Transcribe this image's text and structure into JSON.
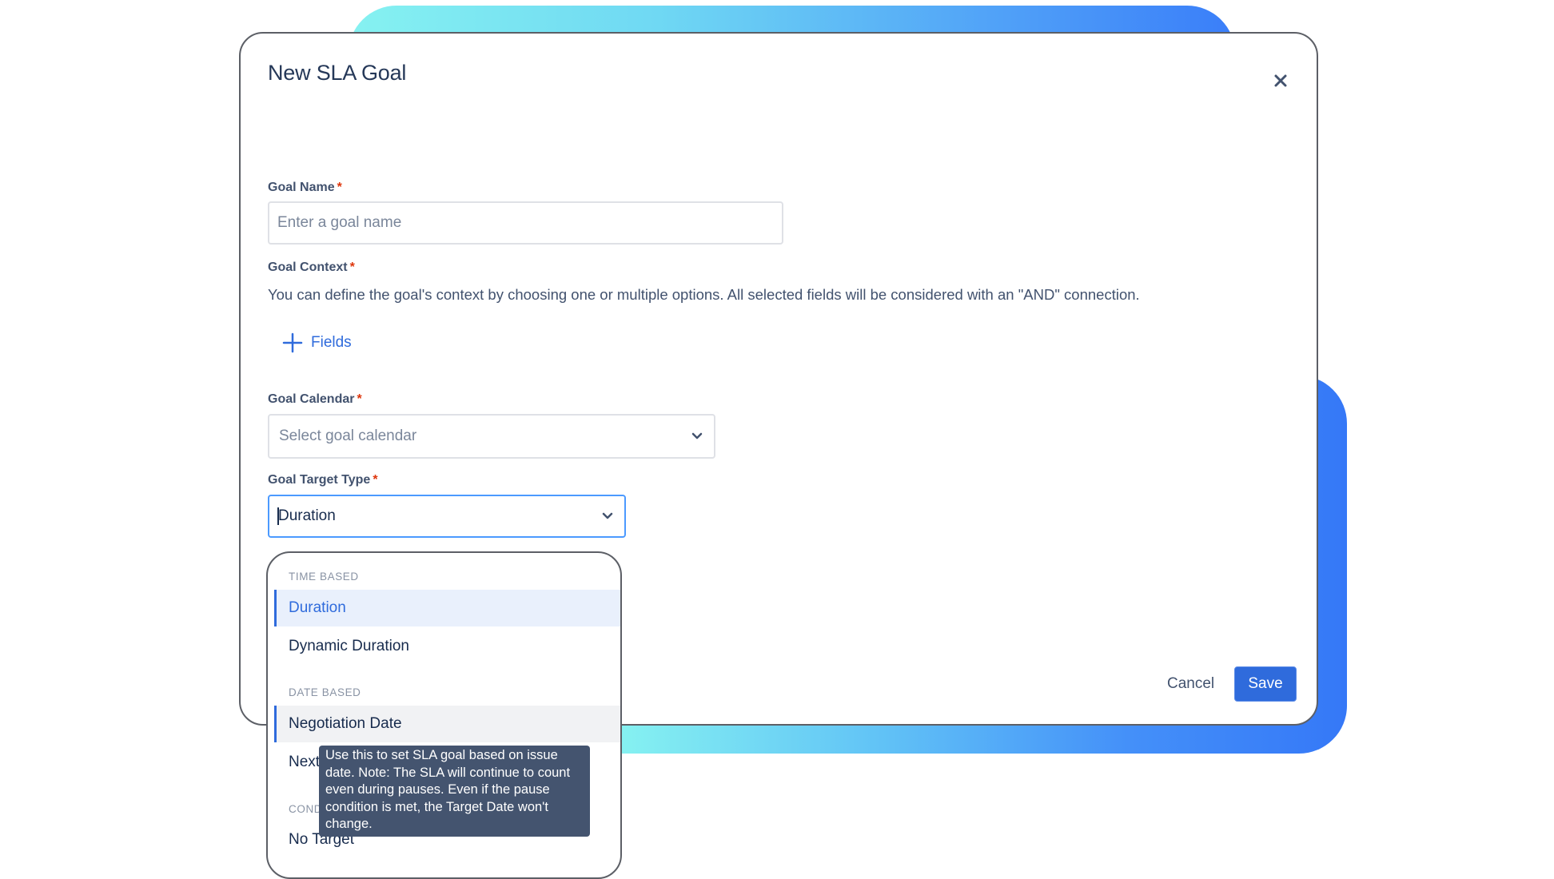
{
  "dialog": {
    "title": "New SLA Goal",
    "close_icon": "close-icon"
  },
  "form": {
    "goal_name": {
      "label": "Goal Name",
      "required_mark": "*",
      "placeholder": "Enter a goal name",
      "value": ""
    },
    "goal_context": {
      "label": "Goal Context",
      "required_mark": "*",
      "description": "You can define the goal's context by choosing one or multiple options. All selected fields will be considered with an \"AND\" connection.",
      "add_fields_label": "Fields",
      "add_icon": "plus-icon"
    },
    "goal_calendar": {
      "label": "Goal Calendar",
      "required_mark": "*",
      "placeholder": "Select goal calendar",
      "icon": "chevron-down-icon"
    },
    "goal_target_type": {
      "label": "Goal Target Type",
      "required_mark": "*",
      "value": "Duration",
      "icon": "chevron-down-icon"
    }
  },
  "dropdown": {
    "groups": [
      {
        "header": "TIME BASED",
        "options": [
          {
            "label": "Duration",
            "state": "selected"
          },
          {
            "label": "Dynamic Duration",
            "state": "normal"
          }
        ]
      },
      {
        "header": "DATE BASED",
        "options": [
          {
            "label": "Negotiation Date",
            "state": "hovered"
          },
          {
            "label": "Next",
            "state": "normal"
          }
        ]
      },
      {
        "header": "COND",
        "options": [
          {
            "label": "No Target",
            "state": "normal"
          }
        ]
      }
    ],
    "tooltip": "Use this to set SLA goal based on issue date. Note: The SLA will continue to count even during pauses. Even if the pause condition is met, the Target Date won't change."
  },
  "footer": {
    "cancel_label": "Cancel",
    "save_label": "Save"
  },
  "colors": {
    "primary": "#2f6bdc",
    "focus_border": "#4c9aff",
    "required": "#de350b",
    "tooltip_bg": "#44546f",
    "gradient_start": "#86f2f1",
    "gradient_end": "#3578f7"
  }
}
